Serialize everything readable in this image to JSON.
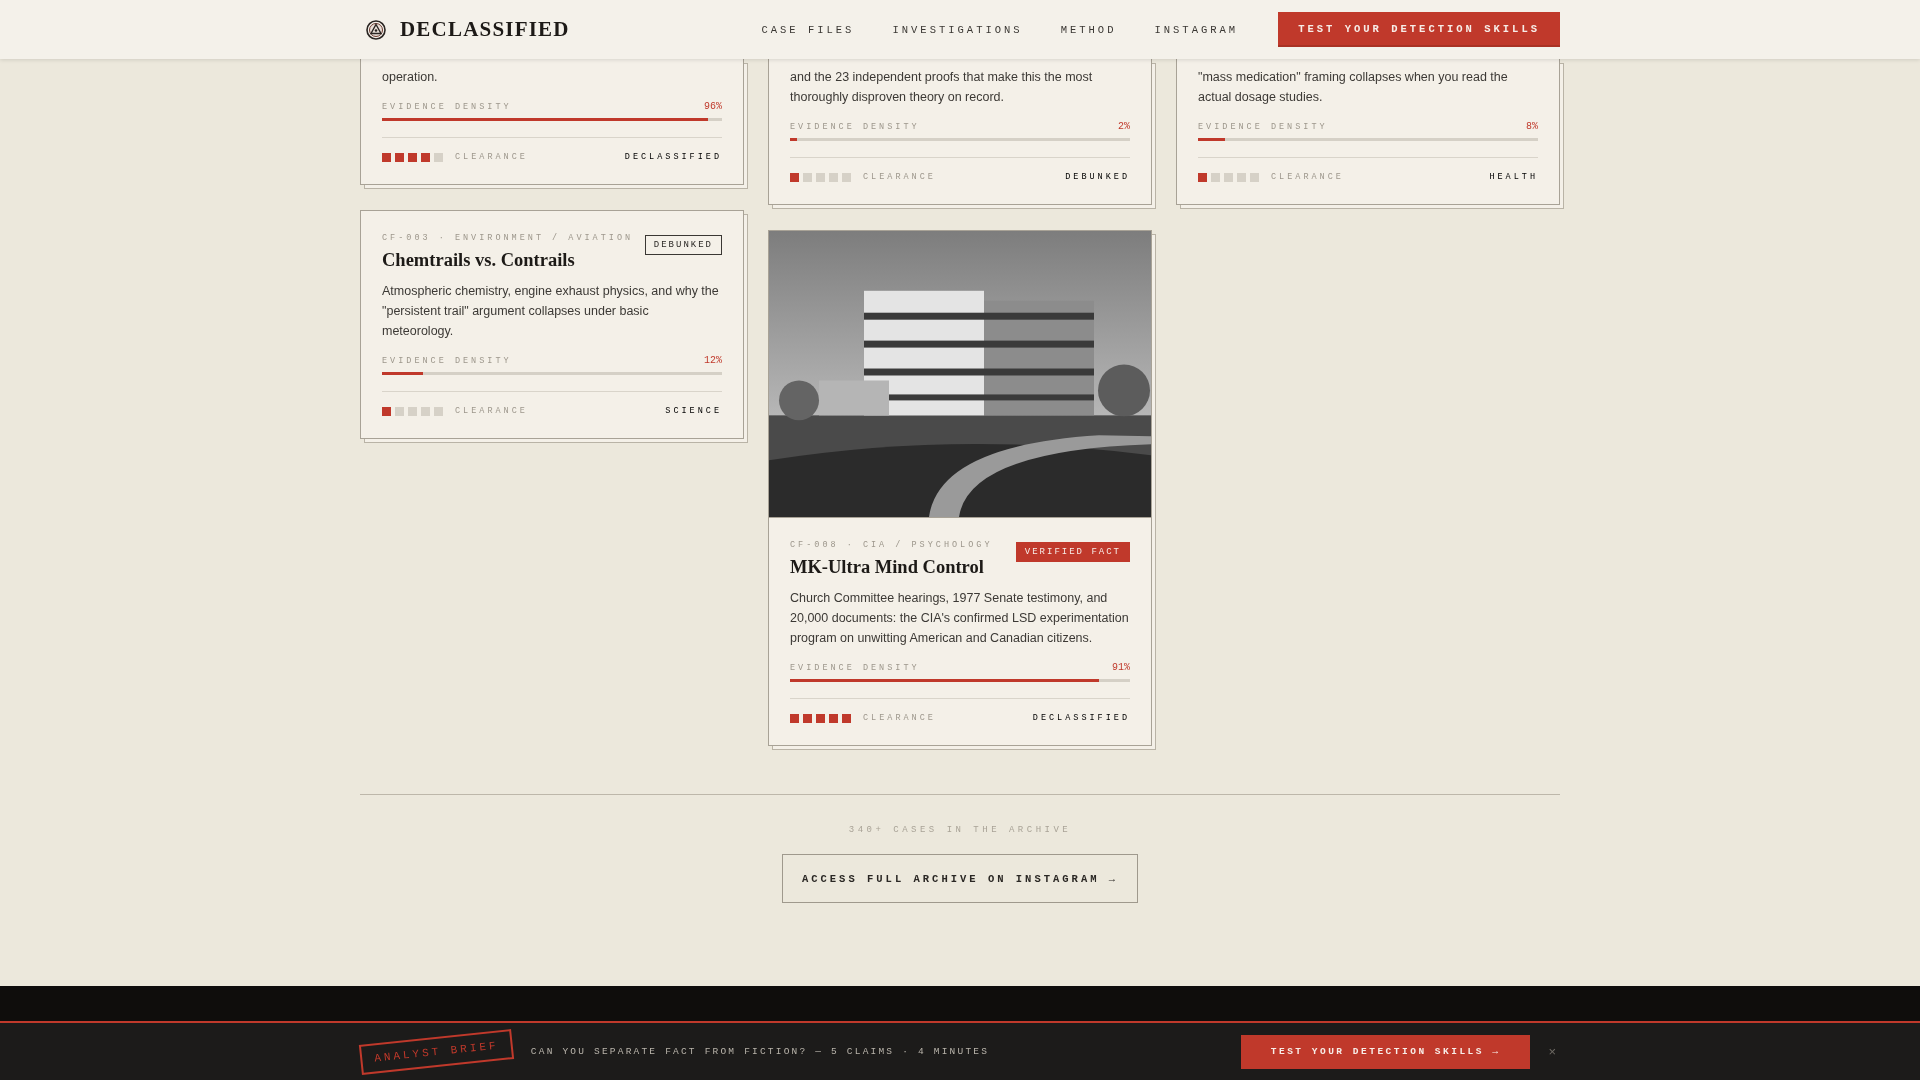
{
  "header": {
    "brand": "DECLASSIFIED",
    "nav": [
      "CASE FILES",
      "INVESTIGATIONS",
      "METHOD",
      "INSTAGRAM"
    ],
    "cta": "TEST YOUR DETECTION SKILLS"
  },
  "columns": [
    {
      "cards": [
        {
          "cut_top": true,
          "description": "operation.",
          "meter_label": "EVIDENCE DENSITY",
          "level": 0.96,
          "reading": "96%",
          "stars": 4,
          "clearance_label": "CLEARANCE",
          "category": "DECLASSIFIED"
        },
        {
          "cut_top": false,
          "meta": "CF-003 · ENVIRONMENT / AVIATION",
          "title": "Chemtrails vs. Contrails",
          "verdict": {
            "kind": "debunked",
            "label": "DEBUNKED"
          },
          "description": "Atmospheric chemistry, engine exhaust physics, and why the \"persistent trail\" argument collapses under basic meteorology.",
          "meter_label": "EVIDENCE DENSITY",
          "level": 0.12,
          "reading": "12%",
          "stars": 1,
          "clearance_label": "CLEARANCE",
          "category": "SCIENCE"
        }
      ]
    },
    {
      "cards": [
        {
          "cut_top": true,
          "description": "and the 23 independent proofs that make this the most thoroughly disproven theory on record.",
          "meter_label": "EVIDENCE DENSITY",
          "level": 0.02,
          "reading": "2%",
          "stars": 1,
          "clearance_label": "CLEARANCE",
          "category": "DEBUNKED"
        },
        {
          "cut_top": false,
          "meta": "CF-008 · CIA / PSYCHOLOGY",
          "title": "MK-Ultra Mind Control",
          "verdict": {
            "kind": "verified",
            "label": "VERIFIED FACT"
          },
          "description": "Church Committee hearings, 1977 Senate testimony, and 20,000 documents: the CIA's confirmed LSD experimentation program on unwitting American and Canadian citizens.",
          "meter_label": "EVIDENCE DENSITY",
          "level": 0.91,
          "reading": "91%",
          "stars": 5,
          "clearance_label": "CLEARANCE",
          "category": "DECLASSIFIED"
        }
      ]
    },
    {
      "cards": [
        {
          "cut_top": true,
          "description": "\"mass medication\" framing collapses when you read the actual dosage studies.",
          "meter_label": "EVIDENCE DENSITY",
          "level": 0.08,
          "reading": "8%",
          "stars": 1,
          "clearance_label": "CLEARANCE",
          "category": "HEALTH"
        }
      ]
    }
  ],
  "archive": {
    "count": "340+ CASES IN THE ARCHIVE",
    "button": "ACCESS FULL ARCHIVE ON INSTAGRAM →"
  },
  "brief_bar": {
    "stamp": "ANALYST BRIEF",
    "message": "CAN YOU SEPARATE FACT FROM FICTION? — 5 CLAIMS · 4 MINUTES",
    "cta": "TEST YOUR DETECTION SKILLS →",
    "close": "×"
  }
}
